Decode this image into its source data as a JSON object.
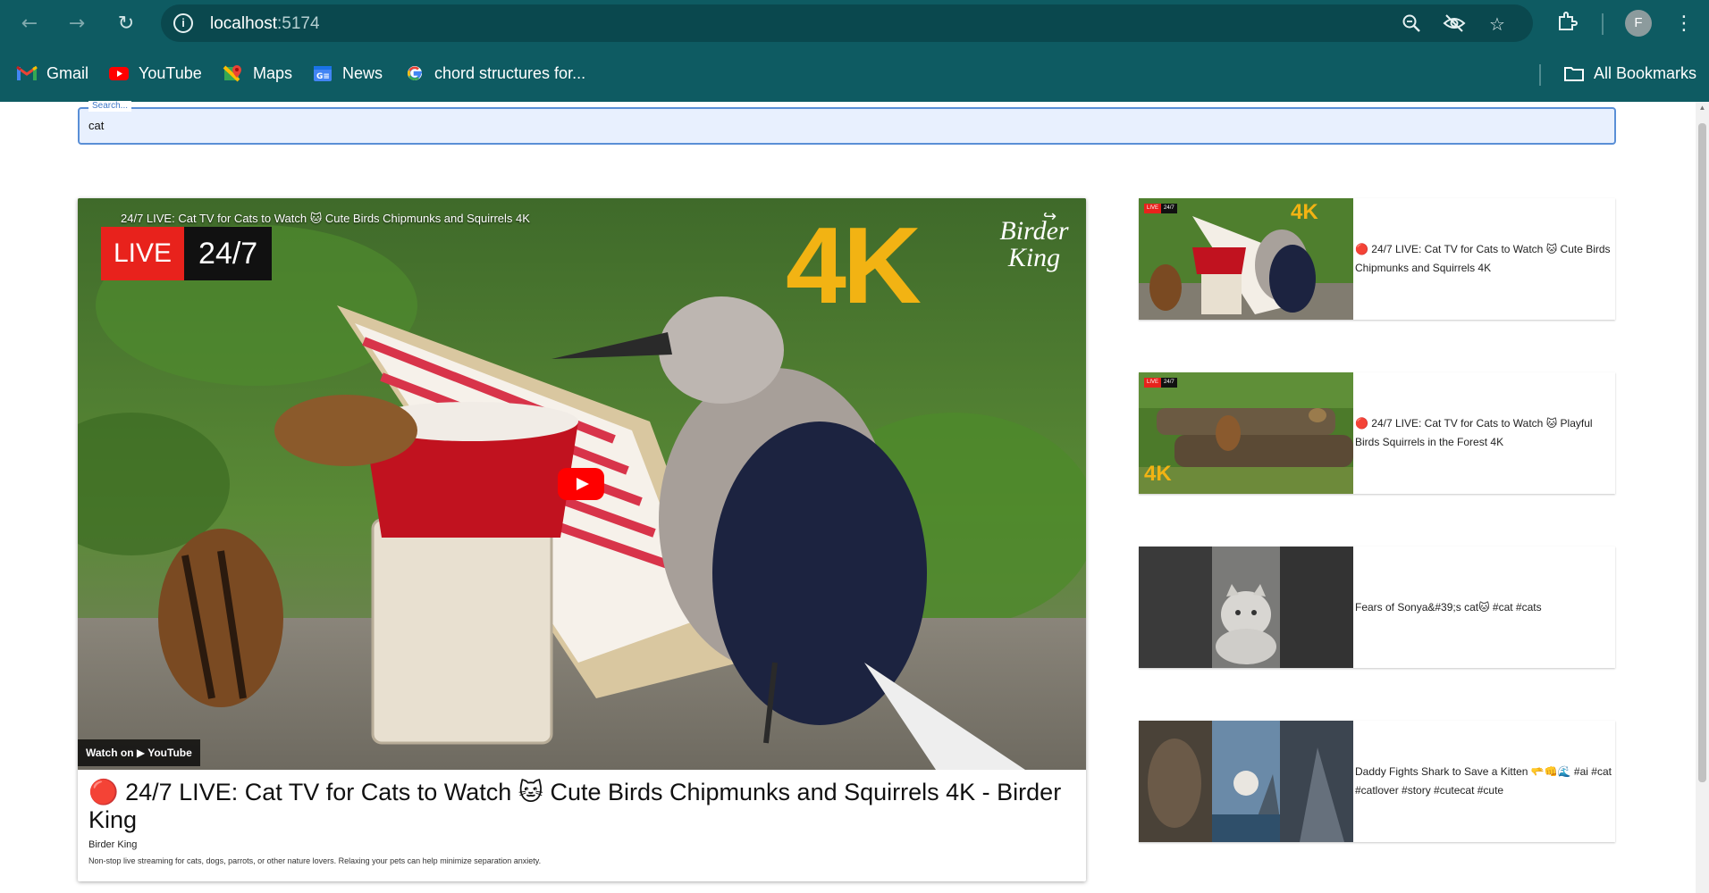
{
  "browser": {
    "url_host": "localhost",
    "url_port": ":5174",
    "bookmarks": [
      {
        "label": "Gmail",
        "icon": "gmail-icon"
      },
      {
        "label": "YouTube",
        "icon": "youtube-icon"
      },
      {
        "label": "Maps",
        "icon": "maps-icon"
      },
      {
        "label": "News",
        "icon": "news-icon"
      },
      {
        "label": "chord structures for...",
        "icon": "google-icon"
      }
    ],
    "all_bookmarks_label": "All Bookmarks",
    "profile_initial": "F"
  },
  "search": {
    "legend": "Search...",
    "value": "cat"
  },
  "main_video": {
    "player_title": "24/7 LIVE: Cat TV for Cats to Watch 🐱 Cute Birds Chipmunks and Squirrels 4K",
    "live_label": "LIVE",
    "live_hours": "24/7",
    "badge_4k": "4K",
    "watermark": "Birder King",
    "watch_on": "Watch on ▶ YouTube",
    "title": "🔴 24/7 LIVE: Cat TV for Cats to Watch 🐱 Cute Birds Chipmunks and Squirrels 4K - Birder King",
    "channel": "Birder King",
    "description": "Non-stop live streaming for cats, dogs, parrots, or other nature lovers. Relaxing your pets can help minimize separation anxiety."
  },
  "results": [
    {
      "title": "🔴 24/7 LIVE: Cat TV for Cats to Watch 🐱 Cute Birds Chipmunks and Squirrels 4K",
      "live_label": "LIVE",
      "live_hours": "24/7",
      "badge_4k": "4K"
    },
    {
      "title": "🔴 24/7 LIVE: Cat TV for Cats to Watch 🐱 Playful Birds Squirrels in the Forest 4K",
      "live_label": "LIVE",
      "live_hours": "24/7",
      "badge_4k": "4K"
    },
    {
      "title": "Fears of Sonya&#39;s cat🐱 #cat #cats"
    },
    {
      "title": "Daddy Fights Shark to Save a Kitten 🫳👊🌊 #ai #cat #catlover #story #cutecat #cute"
    }
  ],
  "colors": {
    "chrome_bg": "#0e5b62",
    "omnibox_bg": "#0a484e",
    "search_focus": "#5a8fd6",
    "search_fill": "#e8f0fe",
    "live_red": "#e8221c",
    "youtube_red": "#ff0000",
    "badge_gold": "#f2b313"
  }
}
